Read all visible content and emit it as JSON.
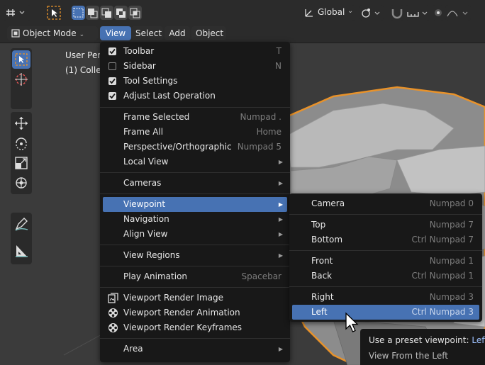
{
  "topbar": {
    "orientation": "Global"
  },
  "header": {
    "mode": "Object Mode",
    "menus": [
      "View",
      "Select",
      "Add",
      "Object"
    ]
  },
  "viewport": {
    "line1": "User Per",
    "line2": "(1) Colle"
  },
  "view_menu": {
    "items": [
      {
        "label": "Toolbar",
        "shortcut": "T",
        "checked": true
      },
      {
        "label": "Sidebar",
        "shortcut": "N",
        "checked": false
      },
      {
        "label": "Tool Settings",
        "shortcut": "",
        "checked": true
      },
      {
        "label": "Adjust Last Operation",
        "shortcut": "",
        "checked": true
      },
      {
        "label": "Frame Selected",
        "shortcut": "Numpad ."
      },
      {
        "label": "Frame All",
        "shortcut": "Home"
      },
      {
        "label": "Perspective/Orthographic",
        "shortcut": "Numpad 5"
      },
      {
        "label": "Local View",
        "submenu": true
      },
      {
        "label": "Cameras",
        "submenu": true
      },
      {
        "label": "Viewpoint",
        "submenu": true,
        "highlighted": true
      },
      {
        "label": "Navigation",
        "submenu": true
      },
      {
        "label": "Align View",
        "submenu": true
      },
      {
        "label": "View Regions",
        "submenu": true
      },
      {
        "label": "Play Animation",
        "shortcut": "Spacebar"
      },
      {
        "label": "Viewport Render Image",
        "icon": "render-image-icon"
      },
      {
        "label": "Viewport Render Animation",
        "icon": "render-animation-icon"
      },
      {
        "label": "Viewport Render Keyframes",
        "icon": "render-animation-icon"
      },
      {
        "label": "Area",
        "submenu": true
      }
    ]
  },
  "viewpoint_menu": {
    "items": [
      {
        "label": "Camera",
        "shortcut": "Numpad 0"
      },
      {
        "label": "Top",
        "shortcut": "Numpad 7"
      },
      {
        "label": "Bottom",
        "shortcut": "Ctrl Numpad 7"
      },
      {
        "label": "Front",
        "shortcut": "Numpad 1"
      },
      {
        "label": "Back",
        "shortcut": "Ctrl Numpad 1"
      },
      {
        "label": "Right",
        "shortcut": "Numpad 3"
      },
      {
        "label": "Left",
        "shortcut": "Ctrl Numpad 3",
        "highlighted": true
      }
    ]
  },
  "tooltip": {
    "line1_prefix": "Use a preset viewpoint:",
    "line1_value": "Left",
    "line2": "View From the Left"
  },
  "colors": {
    "accent": "#4772b3",
    "menu_bg": "#181818",
    "viewport_bg": "#3b3b3b",
    "mesh_outline": "#e8922a"
  }
}
